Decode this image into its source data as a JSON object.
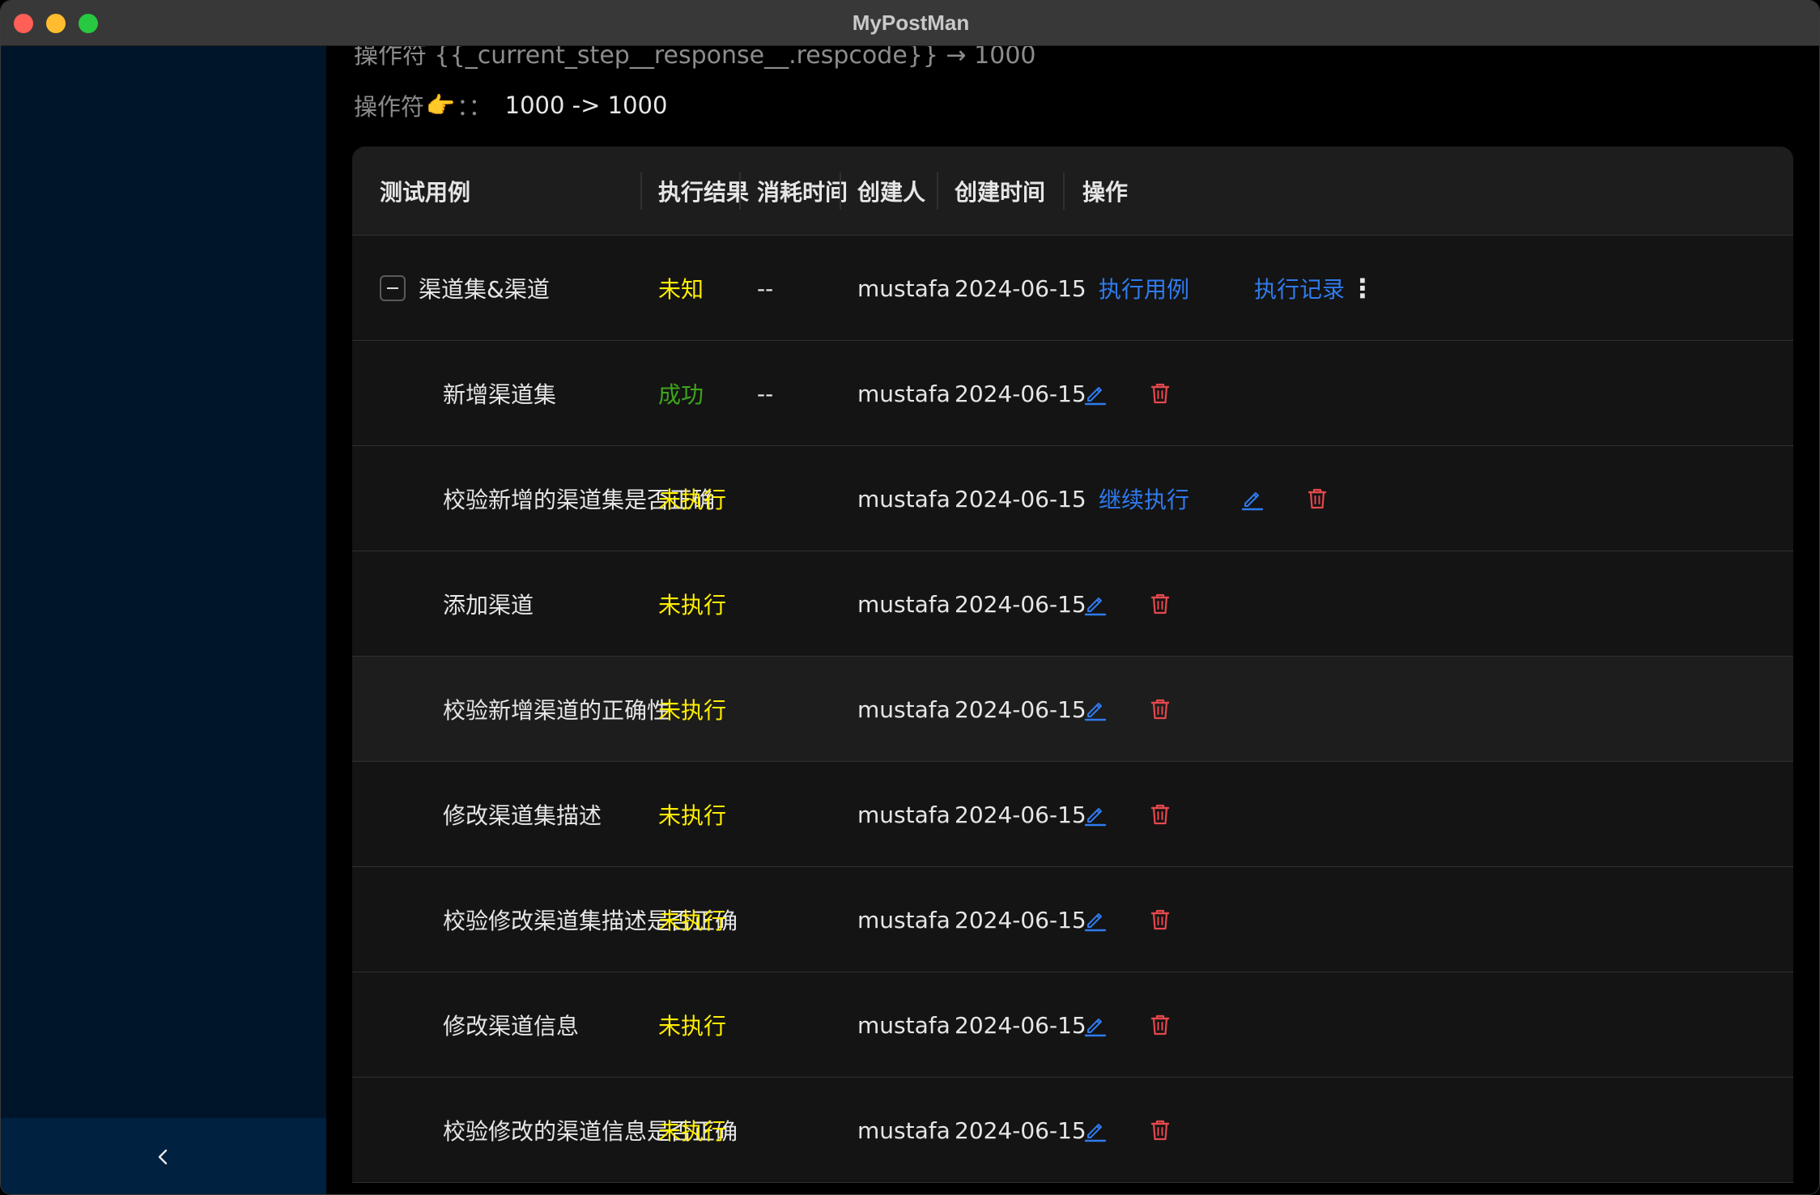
{
  "window": {
    "title": "MyPostMan"
  },
  "sidebar": {
    "collapse_icon": "chevron-left-icon"
  },
  "main": {
    "cutoff_text": "操作符   {{_current_step__response__.respcode}} → 1000",
    "operator": {
      "label": "操作符",
      "hand": "👉",
      "colon": "：：",
      "value": "1000 -> 1000"
    }
  },
  "table": {
    "columns": [
      "测试用例",
      "执行结果",
      "消耗时间",
      "创建人",
      "创建时间",
      "操作"
    ],
    "group": {
      "name": "渠道集&渠道",
      "status": "未知",
      "duration": "--",
      "creator": "mustafa",
      "created": "2024-06-15",
      "actions": {
        "run": "执行用例",
        "history": "执行记录",
        "more": "⋮"
      }
    },
    "rows": [
      {
        "name": "新增渠道集",
        "status": "成功",
        "status_type": "success",
        "duration": "--",
        "creator": "mustafa",
        "created": "2024-06-15",
        "continue": ""
      },
      {
        "name": "校验新增的渠道集是否正确",
        "status": "未执行",
        "status_type": "pending",
        "duration": "",
        "creator": "mustafa",
        "created": "2024-06-15",
        "continue": "继续执行"
      },
      {
        "name": "添加渠道",
        "status": "未执行",
        "status_type": "pending",
        "duration": "",
        "creator": "mustafa",
        "created": "2024-06-15",
        "continue": ""
      },
      {
        "name": "校验新增渠道的正确性",
        "status": "未执行",
        "status_type": "pending",
        "duration": "",
        "creator": "mustafa",
        "created": "2024-06-15",
        "continue": ""
      },
      {
        "name": "修改渠道集描述",
        "status": "未执行",
        "status_type": "pending",
        "duration": "",
        "creator": "mustafa",
        "created": "2024-06-15",
        "continue": ""
      },
      {
        "name": "校验修改渠道集描述是否正确",
        "status": "未执行",
        "status_type": "pending",
        "duration": "",
        "creator": "mustafa",
        "created": "2024-06-15",
        "continue": ""
      },
      {
        "name": "修改渠道信息",
        "status": "未执行",
        "status_type": "pending",
        "duration": "",
        "creator": "mustafa",
        "created": "2024-06-15",
        "continue": ""
      },
      {
        "name": "校验修改的渠道信息是否正确",
        "status": "未执行",
        "status_type": "pending",
        "duration": "",
        "creator": "mustafa",
        "created": "2024-06-15",
        "continue": ""
      }
    ]
  },
  "colors": {
    "link": "#2f7bf0",
    "delete": "#e5484d",
    "pending": "#ffee00",
    "success": "#3fa51d",
    "sidebar": "#001529"
  }
}
